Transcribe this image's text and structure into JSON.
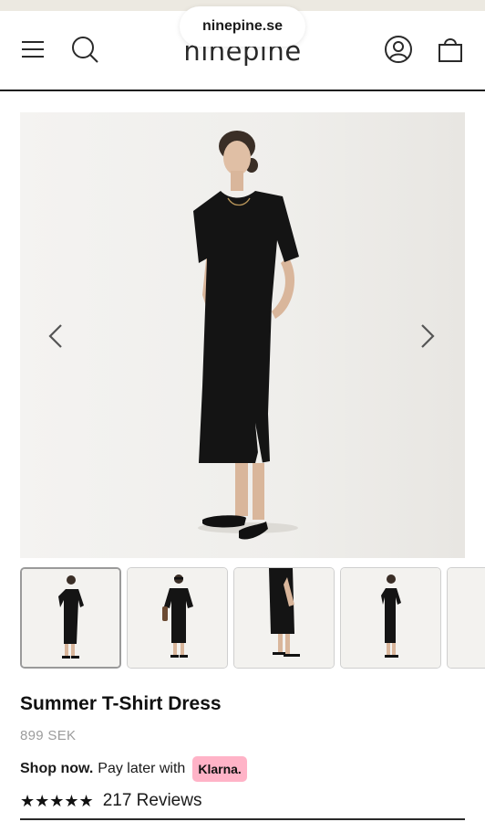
{
  "browser": {
    "url": "ninepine.se"
  },
  "header": {
    "logo": "ninepine",
    "menu_icon": "hamburger-menu-icon",
    "search_icon": "search-icon",
    "account_icon": "account-icon",
    "cart_icon": "shopping-bag-icon"
  },
  "gallery": {
    "prev_icon": "chevron-left-icon",
    "next_icon": "chevron-right-icon",
    "thumbnail_count_visible": 5,
    "active_thumbnail": 1
  },
  "product": {
    "title": "Summer T-Shirt Dress",
    "price": "899 SEK",
    "klarna_bold": "Shop now.",
    "klarna_text": "Pay later with",
    "klarna_badge": "Klarna.",
    "stars": "★★★★★",
    "rating_value": 5,
    "reviews": "217 Reviews"
  },
  "colors": {
    "klarna_pink": "#ffb3c7",
    "border_dark": "#1e1e1e",
    "price_grey": "#9c9c9c",
    "dress_black": "#141414"
  }
}
